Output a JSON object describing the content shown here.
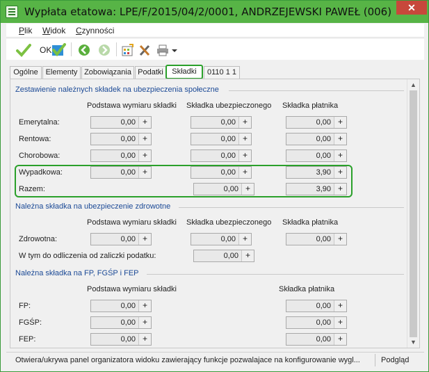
{
  "window": {
    "title": "Wypłata etatowa: LPE/F/2015/04/2/0001, ANDRZEJEWSKI PAWEŁ (006)",
    "close_glyph": "✕"
  },
  "menu": {
    "plik": "Plik",
    "widok": "Widok",
    "czynnosci": "Czynności"
  },
  "toolbar": {
    "ok_label": "OK"
  },
  "tabs": [
    "Ogólne",
    "Elementy",
    "Zobowiązania",
    "Podatki",
    "Składki",
    "0110 1 1"
  ],
  "active_tab": "Składki",
  "section1": {
    "title": "Zestawienie należnych składek na ubezpieczenia społeczne",
    "col_base": "Podstawa wymiaru składki",
    "col_insured": "Składka ubezpieczonego",
    "col_payer": "Składka płatnika",
    "rows": [
      {
        "label": "Emerytalna:",
        "base": "0,00",
        "insured": "0,00",
        "payer": "0,00"
      },
      {
        "label": "Rentowa:",
        "base": "0,00",
        "insured": "0,00",
        "payer": "0,00"
      },
      {
        "label": "Chorobowa:",
        "base": "0,00",
        "insured": "0,00",
        "payer": "0,00"
      },
      {
        "label": "Wypadkowa:",
        "base": "0,00",
        "insured": "0,00",
        "payer": "3,90"
      }
    ],
    "total": {
      "label": "Razem:",
      "insured": "0,00",
      "payer": "3,90"
    }
  },
  "section2": {
    "title": "Należna składka na ubezpieczenie zdrowotne",
    "col_base": "Podstawa wymiaru składki",
    "col_insured": "Składka ubezpieczonego",
    "col_payer": "Składka płatnika",
    "health": {
      "label": "Zdrowotna:",
      "base": "0,00",
      "insured": "0,00",
      "payer": "0,00"
    },
    "deduct": {
      "label": "W tym do odliczenia od zaliczki podatku:",
      "value": "0,00"
    }
  },
  "section3": {
    "title": "Należna składka na FP, FGŚP i FEP",
    "col_base": "Podstawa wymiaru składki",
    "col_payer": "Składka płatnika",
    "rows": [
      {
        "label": "FP:",
        "base": "0,00",
        "payer": "0,00"
      },
      {
        "label": "FGŚP:",
        "base": "0,00",
        "payer": "0,00"
      },
      {
        "label": "FEP:",
        "base": "0,00",
        "payer": "0,00"
      }
    ]
  },
  "plus_glyph": "+",
  "status": {
    "text": "Otwiera/ukrywa panel organizatora widoku zawierający funkcje pozwalajace na konfigurowanie wygl...",
    "mode": "Podgląd"
  },
  "colors": {
    "titlebar": "#57b446",
    "accent_green": "#2aa02a",
    "section_blue": "#1c4a96",
    "close_red": "#c7483b"
  },
  "icons": [
    "app-icon",
    "ok-check-icon",
    "save-check-icon",
    "back-arrow-icon",
    "forward-arrow-icon",
    "calculator-icon",
    "tools-icon",
    "print-icon",
    "dropdown-arrow-icon",
    "scroll-up-icon",
    "scroll-down-icon"
  ]
}
